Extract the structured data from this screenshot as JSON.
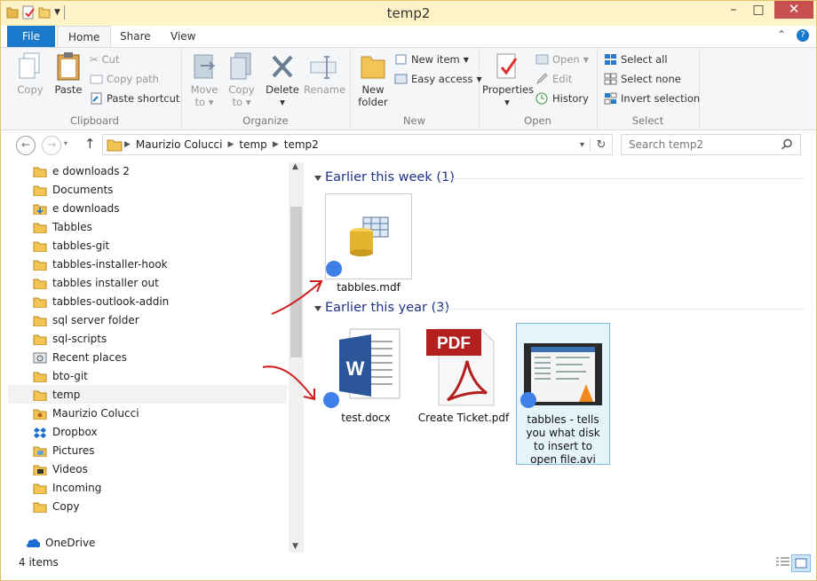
{
  "window": {
    "title": "temp2",
    "minimize": "–",
    "maximize": "□",
    "close": "✕"
  },
  "ribbon_tabs": {
    "file": "File",
    "home": "Home",
    "share": "Share",
    "view": "View"
  },
  "clipboard": {
    "copy": "Copy",
    "paste": "Paste",
    "cut": "Cut",
    "copy_path": "Copy path",
    "paste_shortcut": "Paste shortcut",
    "label": "Clipboard"
  },
  "organize": {
    "move_to": "Move",
    "move_to_2": "to",
    "copy_to": "Copy",
    "copy_to_2": "to",
    "delete": "Delete",
    "rename": "Rename",
    "label": "Organize"
  },
  "new": {
    "new_folder": "New",
    "new_folder_2": "folder",
    "new_item": "New item",
    "easy_access": "Easy access",
    "label": "New"
  },
  "open": {
    "properties": "Properties",
    "open": "Open",
    "edit": "Edit",
    "history": "History",
    "label": "Open"
  },
  "select": {
    "select_all": "Select all",
    "select_none": "Select none",
    "invert": "Invert selection",
    "label": "Select"
  },
  "address": {
    "crumbs": [
      "Maurizio Colucci",
      "temp",
      "temp2"
    ],
    "search_placeholder": "Search temp2"
  },
  "nav_items": [
    {
      "label": "e downloads 2",
      "icon": "folder-icon"
    },
    {
      "label": "Documents",
      "icon": "folder-icon"
    },
    {
      "label": "e downloads",
      "icon": "folder-download-icon"
    },
    {
      "label": "Tabbles",
      "icon": "folder-icon"
    },
    {
      "label": "tabbles-git",
      "icon": "folder-icon"
    },
    {
      "label": "tabbles-installer-hook",
      "icon": "folder-icon"
    },
    {
      "label": "tabbles installer out",
      "icon": "folder-icon"
    },
    {
      "label": "tabbles-outlook-addin",
      "icon": "folder-icon"
    },
    {
      "label": "sql server folder",
      "icon": "folder-icon"
    },
    {
      "label": "sql-scripts",
      "icon": "folder-icon"
    },
    {
      "label": "Recent places",
      "icon": "recent-places-icon"
    },
    {
      "label": "bto-git",
      "icon": "folder-icon"
    },
    {
      "label": "temp",
      "icon": "folder-icon"
    },
    {
      "label": "Maurizio Colucci",
      "icon": "user-folder-icon"
    },
    {
      "label": "Dropbox",
      "icon": "dropbox-icon"
    },
    {
      "label": "Pictures",
      "icon": "pictures-folder-icon"
    },
    {
      "label": "Videos",
      "icon": "videos-folder-icon"
    },
    {
      "label": "Incoming",
      "icon": "folder-icon"
    },
    {
      "label": "Copy",
      "icon": "folder-icon"
    }
  ],
  "onedrive": "OneDrive",
  "groups": [
    {
      "header": "Earlier this week (1)",
      "files": [
        {
          "name": "tabbles.mdf",
          "icon": "database-file-icon"
        }
      ]
    },
    {
      "header": "Earlier this year (3)",
      "files": [
        {
          "name": "test.docx",
          "icon": "word-document-icon"
        },
        {
          "name": "Create Ticket.pdf",
          "icon": "pdf-file-icon",
          "badge": "PDF"
        },
        {
          "name": "tabbles - tells you what disk to insert to open file.avi",
          "icon": "video-file-icon"
        }
      ]
    }
  ],
  "status": {
    "count": "4 items"
  },
  "colors": {
    "accent": "#1979ca",
    "title_bar": "#fff3c7",
    "annotation_arrow": "#d01c1c",
    "sync_dot": "#3f7fe8"
  }
}
